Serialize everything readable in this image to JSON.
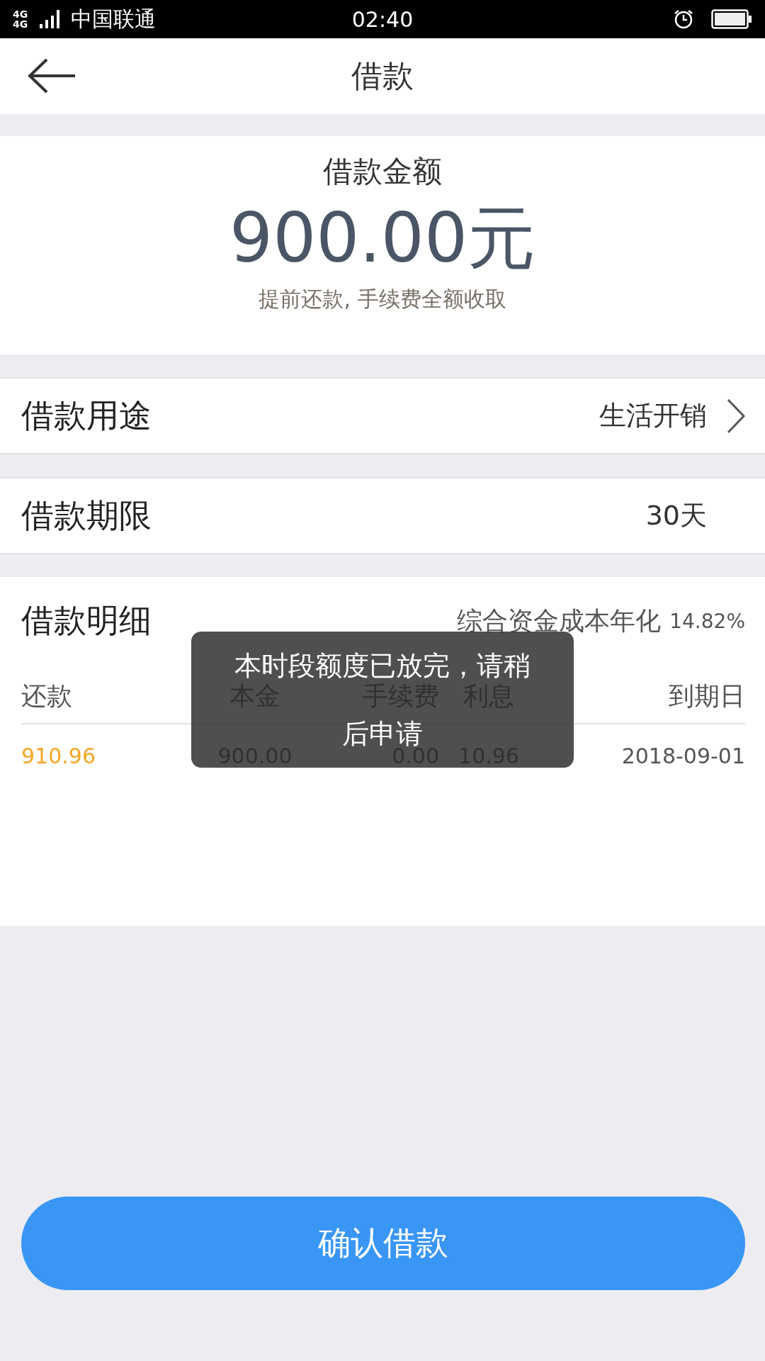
{
  "status_bar": {
    "network": "4G 4G",
    "carrier": "中国联通",
    "time": "02:40"
  },
  "nav": {
    "title": "借款"
  },
  "amount_card": {
    "label": "借款金额",
    "amount": "900.00元",
    "note": "提前还款, 手续费全额收取"
  },
  "fields": [
    {
      "kind": "select",
      "label": "借款用途",
      "value": "生活开销"
    },
    {
      "kind": "static",
      "label": "借款期限",
      "value": "30天"
    }
  ],
  "details": {
    "title": "借款明细",
    "rate_label": "综合资金成本年化",
    "rate": "14.82%",
    "columns": [
      "还款",
      "本金",
      "手续费",
      "利息",
      "到期日"
    ],
    "rows": [
      [
        "910.96",
        "900.00",
        "0.00",
        "10.96",
        "2018-09-01"
      ]
    ]
  },
  "toast": {
    "message": "本时段额度已放完，请稍后申请"
  },
  "confirm_button": "确认借款"
}
